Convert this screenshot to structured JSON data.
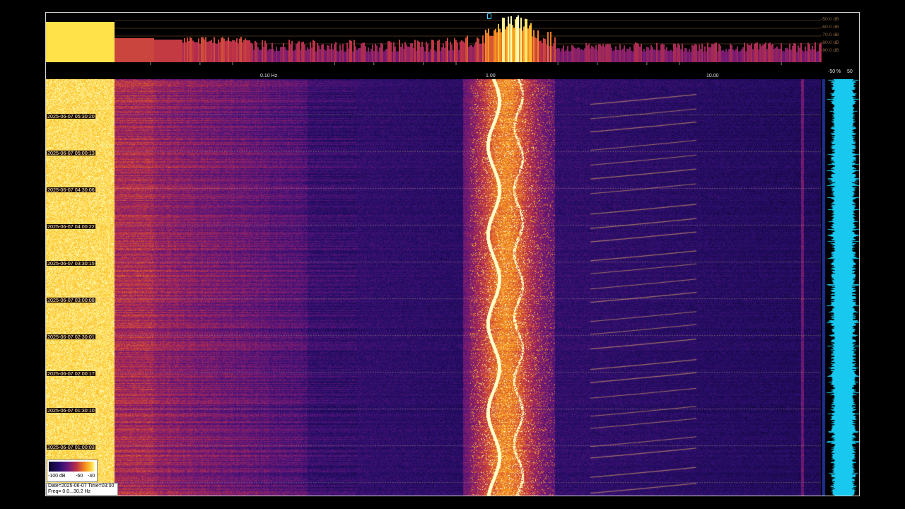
{
  "spectrum": {
    "db_labels": [
      "-50.0 dB",
      "-60.0 dB",
      "-70.0 dB",
      "-80.0 dB",
      "-90.0 dB"
    ]
  },
  "freq_axis": {
    "labels": [
      "0.10 Hz",
      "1.00",
      "10.00"
    ]
  },
  "meter": {
    "labels": [
      "-50 %",
      "50"
    ]
  },
  "timestamps": [
    "2025-06-07 05:30:20",
    "2025-06-07 05:00:13",
    "2025-06-07 04:30:06",
    "2025-06-07 04:00:22",
    "2025-06-07 03:30:15",
    "2025-06-07 03:00:08",
    "2025-06-07 02:30:01",
    "2025-06-07 02:00:17",
    "2025-06-07 01:30:10",
    "2025-06-07 01:00:03"
  ],
  "legend": {
    "labels": [
      "-100 dB",
      "-60",
      "-40"
    ]
  },
  "info": {
    "line1": "Date=2025-06-07 Time=03:00",
    "line2": "Freq= 0.0...30.2 Hz"
  },
  "colors": {
    "background": "#000000",
    "waterfall_low": "#1a0a5e",
    "waterfall_high": "#ffe14a",
    "meter": "#19c8ee"
  }
}
